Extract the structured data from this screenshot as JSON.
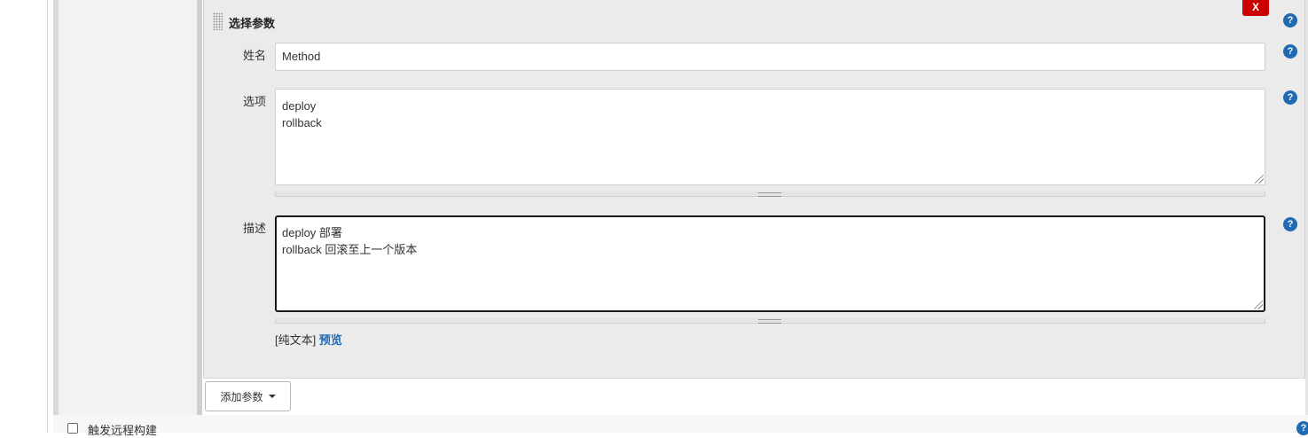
{
  "section": {
    "title": "选择参数",
    "close_label": "X"
  },
  "fields": {
    "name": {
      "label": "姓名",
      "value": "Method"
    },
    "choices": {
      "label": "选项",
      "value": "deploy\nrollback"
    },
    "description": {
      "label": "描述",
      "value": "deploy 部署\nrollback 回滚至上一个版本"
    }
  },
  "format": {
    "current": "[纯文本]",
    "preview_label": "预览"
  },
  "add_param_label": "添加参数",
  "bottom_option": {
    "label": "触发远程构建"
  },
  "help_label": "?",
  "colors": {
    "help_blue": "#1f6ab3",
    "close_red": "#cc0000",
    "panel_bg": "#ebebeb"
  }
}
